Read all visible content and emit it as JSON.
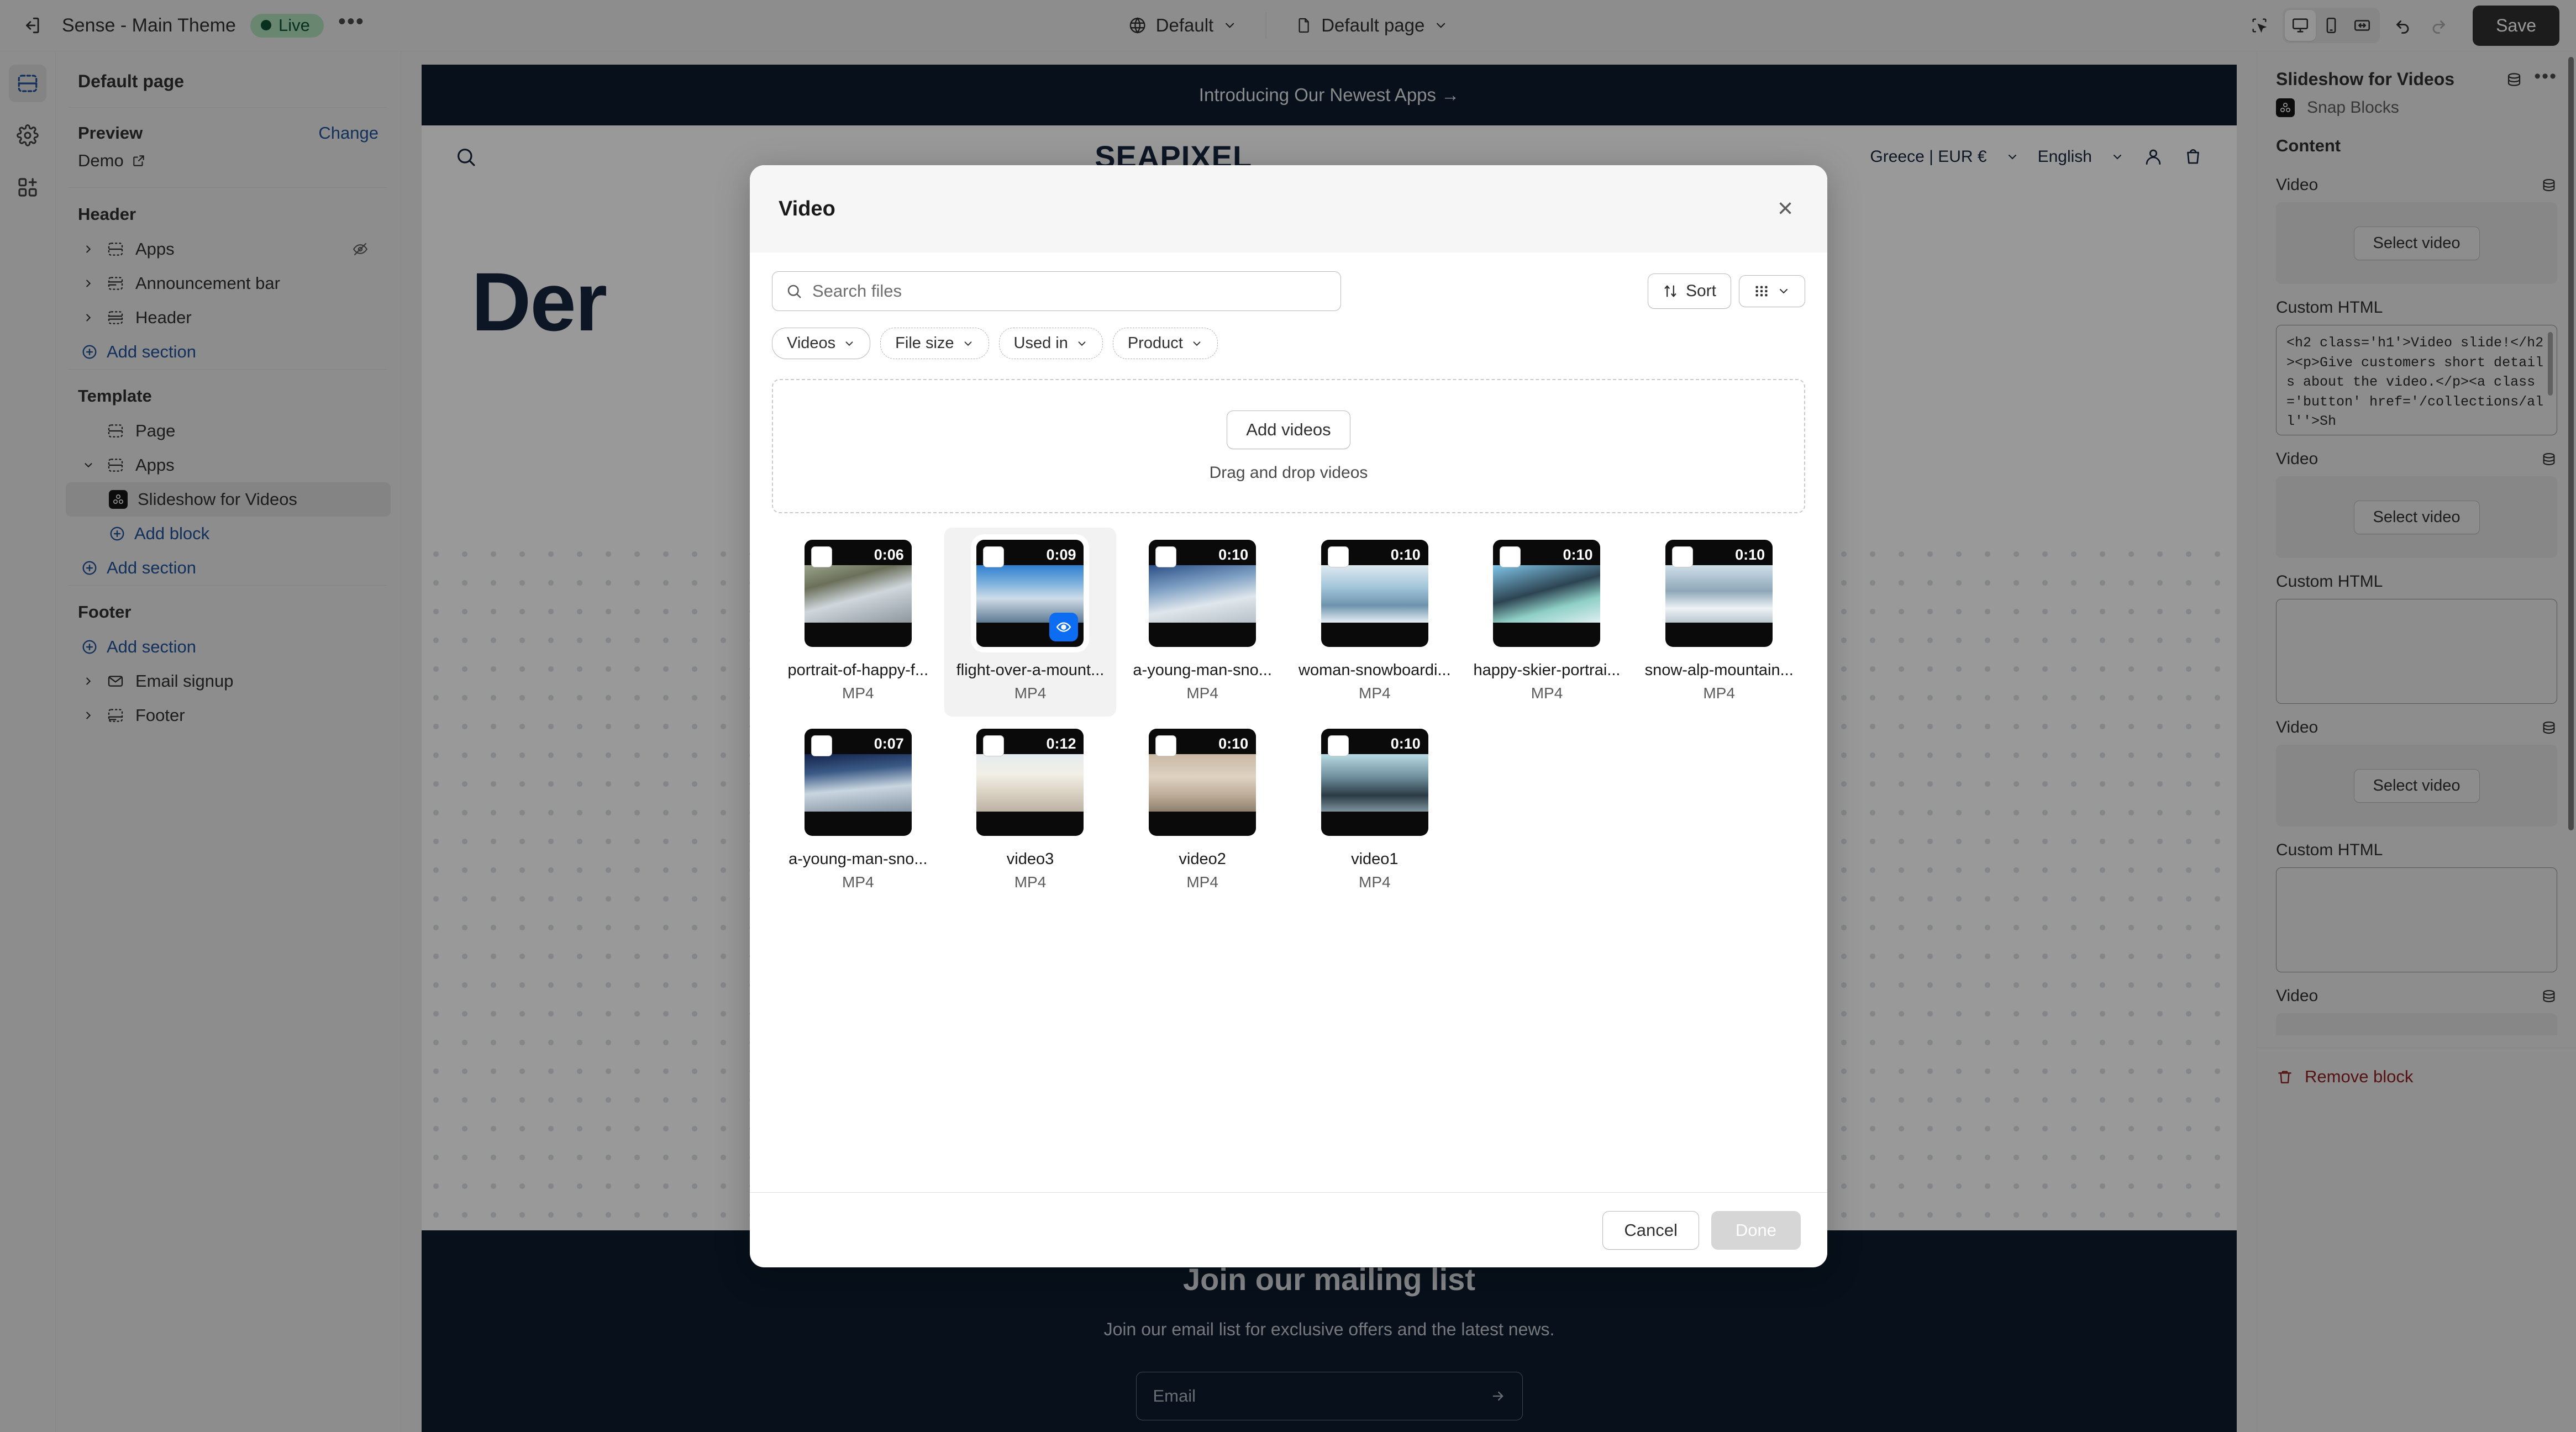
{
  "topbar": {
    "back_icon": "exit-icon",
    "theme_name": "Sense - Main Theme",
    "live_label": "Live",
    "more_label": "•••",
    "market_label": "Default",
    "page_label": "Default page",
    "save_label": "Save"
  },
  "sidebar": {
    "title": "Default page",
    "preview_label": "Preview",
    "change_label": "Change",
    "demo_label": "Demo",
    "groups": [
      {
        "title": "Header",
        "rows": [
          {
            "label": "Apps",
            "icon": "section-icon",
            "chevron": "right",
            "trailing": "hidden-eye-icon"
          },
          {
            "label": "Announcement bar",
            "icon": "announcement-icon",
            "chevron": "right",
            "trailing": ""
          },
          {
            "label": "Header",
            "icon": "header-icon",
            "chevron": "right",
            "trailing": ""
          }
        ],
        "add_label": "Add section"
      },
      {
        "title": "Template",
        "rows": [
          {
            "label": "Page",
            "icon": "section-icon",
            "chevron": "",
            "trailing": ""
          },
          {
            "label": "Apps",
            "icon": "section-icon",
            "chevron": "down",
            "trailing": ""
          }
        ],
        "child": {
          "label": "Slideshow for Videos",
          "icon": "snap-blocks-icon",
          "selected": true
        },
        "add_block_label": "Add block",
        "add_label": "Add section"
      },
      {
        "title": "Footer",
        "add_label": "Add section",
        "rows": [
          {
            "label": "Email signup",
            "icon": "email-icon",
            "chevron": "right",
            "trailing": ""
          },
          {
            "label": "Footer",
            "icon": "footer-icon",
            "chevron": "right",
            "trailing": ""
          }
        ]
      }
    ]
  },
  "preview": {
    "announcement": "Introducing Our Newest Apps  →",
    "logo": "SEAPIXEL",
    "country_currency": "Greece | EUR €",
    "language": "English",
    "hero": "Der",
    "mail_title": "Join our mailing list",
    "mail_sub": "Join our email list for exclusive offers and the latest news.",
    "mail_placeholder": "Email"
  },
  "modal": {
    "title": "Video",
    "close_label": "×",
    "search_placeholder": "Search files",
    "search_value": "",
    "sort_label": "Sort",
    "view_label": "grid-view-icon",
    "filters": [
      {
        "label": "Videos",
        "style": "solid"
      },
      {
        "label": "File size",
        "style": "dash"
      },
      {
        "label": "Used in",
        "style": "dash"
      },
      {
        "label": "Product",
        "style": "dash"
      }
    ],
    "dropzone": {
      "button": "Add videos",
      "hint": "Drag and drop videos"
    },
    "videos": [
      {
        "name": "portrait-of-happy-f...",
        "type": "MP4",
        "duration": "0:06",
        "selected": false,
        "preview": false,
        "g": "g1"
      },
      {
        "name": "flight-over-a-mount...",
        "type": "MP4",
        "duration": "0:09",
        "selected": true,
        "preview": true,
        "g": "g2"
      },
      {
        "name": "a-young-man-sno...",
        "type": "MP4",
        "duration": "0:10",
        "selected": false,
        "preview": false,
        "g": "g3"
      },
      {
        "name": "woman-snowboardi...",
        "type": "MP4",
        "duration": "0:10",
        "selected": false,
        "preview": false,
        "g": "g4"
      },
      {
        "name": "happy-skier-portrai...",
        "type": "MP4",
        "duration": "0:10",
        "selected": false,
        "preview": false,
        "g": "g5"
      },
      {
        "name": "snow-alp-mountain...",
        "type": "MP4",
        "duration": "0:10",
        "selected": false,
        "preview": false,
        "g": "g6"
      },
      {
        "name": "a-young-man-sno...",
        "type": "MP4",
        "duration": "0:07",
        "selected": false,
        "preview": false,
        "g": "g7"
      },
      {
        "name": "video3",
        "type": "MP4",
        "duration": "0:12",
        "selected": false,
        "preview": false,
        "g": "g8"
      },
      {
        "name": "video2",
        "type": "MP4",
        "duration": "0:10",
        "selected": false,
        "preview": false,
        "g": "g9"
      },
      {
        "name": "video1",
        "type": "MP4",
        "duration": "0:10",
        "selected": false,
        "preview": false,
        "g": "g10"
      }
    ],
    "cancel_label": "Cancel",
    "done_label": "Done"
  },
  "rightpanel": {
    "title": "Slideshow for Videos",
    "app_name": "Snap Blocks",
    "section_label": "Content",
    "video_label": "Video",
    "select_video_label": "Select video",
    "custom_html_label": "Custom HTML",
    "custom_html_value": "<h2 class='h1'>Video slide!</h2><p>Give customers short details about the video.</p><a class='button' href='/collections/all''>Sh",
    "remove_block_label": "Remove block"
  },
  "colors": {
    "accent_blue": "#1f5199",
    "select_blue": "#0c6cf2",
    "live_bg": "#afe0bd",
    "live_fg": "#0c5132",
    "danger": "#8e1f1f",
    "dark_navy": "#0d1b2d",
    "save_bg": "#303030"
  }
}
